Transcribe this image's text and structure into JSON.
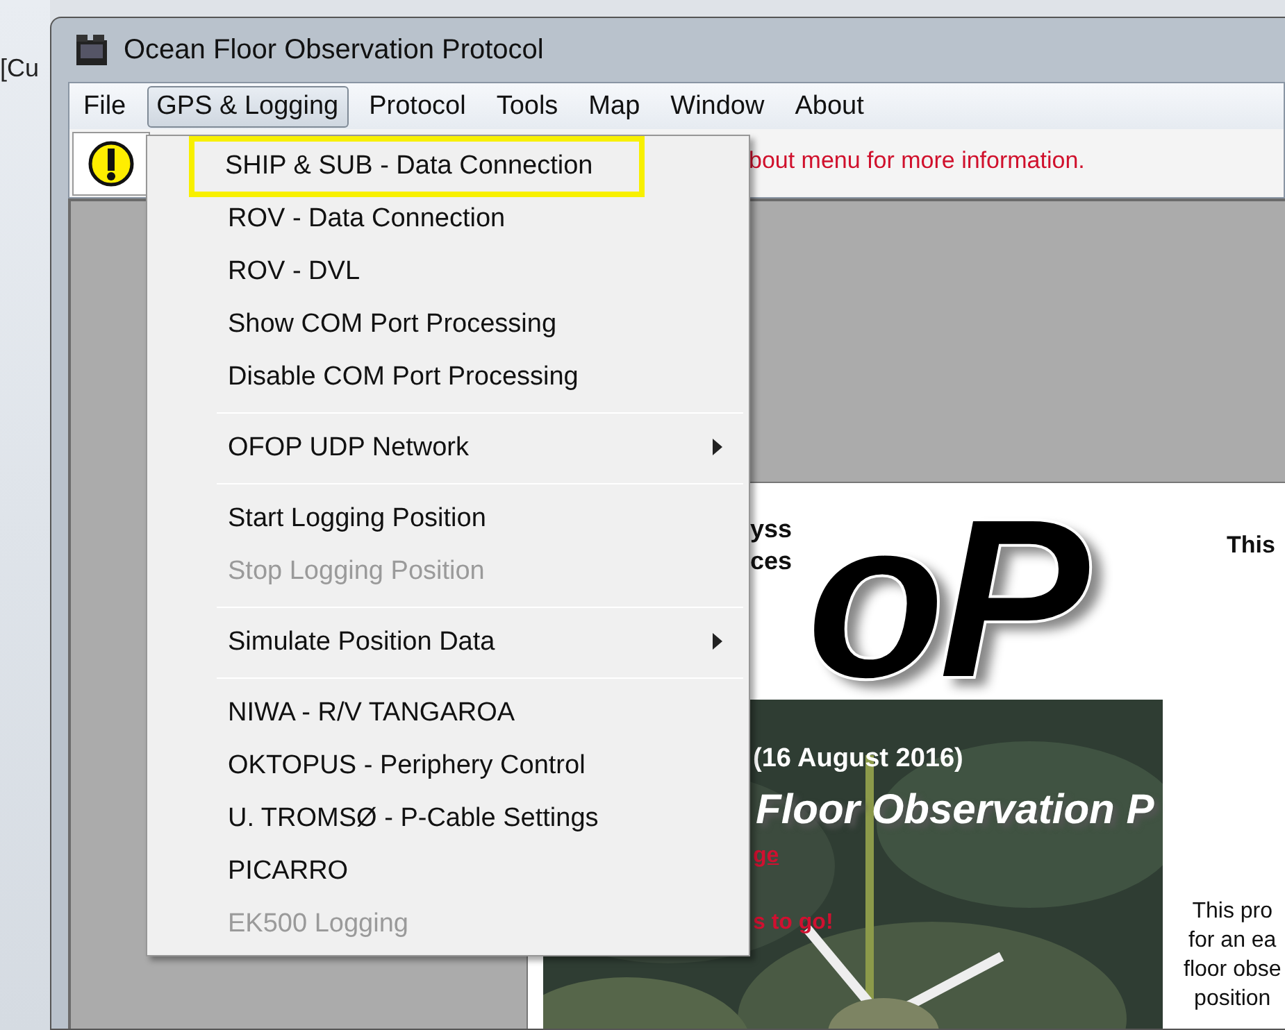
{
  "background_window": {
    "title_fragment": "[Cu"
  },
  "window": {
    "title": "Ocean Floor Observation Protocol"
  },
  "menu_bar": [
    {
      "label": "File",
      "selected": false
    },
    {
      "label": "GPS & Logging",
      "selected": true
    },
    {
      "label": "Protocol",
      "selected": false
    },
    {
      "label": "Tools",
      "selected": false
    },
    {
      "label": "Map",
      "selected": false
    },
    {
      "label": "Window",
      "selected": false
    },
    {
      "label": "About",
      "selected": false
    }
  ],
  "toolbar": {
    "message": "bout menu for more information."
  },
  "dropdown": {
    "items": [
      {
        "kind": "item",
        "label": "SHIP & SUB - Data Connection",
        "disabled": false,
        "highlighted": true,
        "submenu": false
      },
      {
        "kind": "item",
        "label": "ROV - Data Connection",
        "disabled": false,
        "highlighted": false,
        "submenu": false
      },
      {
        "kind": "item",
        "label": "ROV - DVL",
        "disabled": false,
        "highlighted": false,
        "submenu": false
      },
      {
        "kind": "item",
        "label": "Show COM Port Processing",
        "disabled": false,
        "highlighted": false,
        "submenu": false
      },
      {
        "kind": "item",
        "label": "Disable COM Port Processing",
        "disabled": false,
        "highlighted": false,
        "submenu": false
      },
      {
        "kind": "separator"
      },
      {
        "kind": "item",
        "label": "OFOP UDP Network",
        "disabled": false,
        "highlighted": false,
        "submenu": true
      },
      {
        "kind": "separator"
      },
      {
        "kind": "item",
        "label": "Start Logging Position",
        "disabled": false,
        "highlighted": false,
        "submenu": false
      },
      {
        "kind": "item",
        "label": "Stop Logging Position",
        "disabled": true,
        "highlighted": false,
        "submenu": false
      },
      {
        "kind": "separator"
      },
      {
        "kind": "item",
        "label": "Simulate Position Data",
        "disabled": false,
        "highlighted": false,
        "submenu": true
      },
      {
        "kind": "separator"
      },
      {
        "kind": "item",
        "label": "NIWA - R/V TANGAROA",
        "disabled": false,
        "highlighted": false,
        "submenu": false
      },
      {
        "kind": "item",
        "label": "OKTOPUS - Periphery Control",
        "disabled": false,
        "highlighted": false,
        "submenu": false
      },
      {
        "kind": "item",
        "label": "U. TROMSØ - P-Cable Settings",
        "disabled": false,
        "highlighted": false,
        "submenu": false
      },
      {
        "kind": "item",
        "label": "PICARRO",
        "disabled": false,
        "highlighted": false,
        "submenu": false
      },
      {
        "kind": "item",
        "label": "EK500 Logging",
        "disabled": true,
        "highlighted": false,
        "submenu": false
      }
    ]
  },
  "splash": {
    "heading_lines": [
      "yss",
      "ces"
    ],
    "logo": "oP",
    "side_title": "This",
    "date": "(16 August 2016)",
    "subtitle": "Floor Observation P",
    "red_lines": [
      "ge",
      "s to go!"
    ],
    "description_lines": [
      "This pro",
      "for an ea",
      "floor obse",
      "position"
    ]
  }
}
